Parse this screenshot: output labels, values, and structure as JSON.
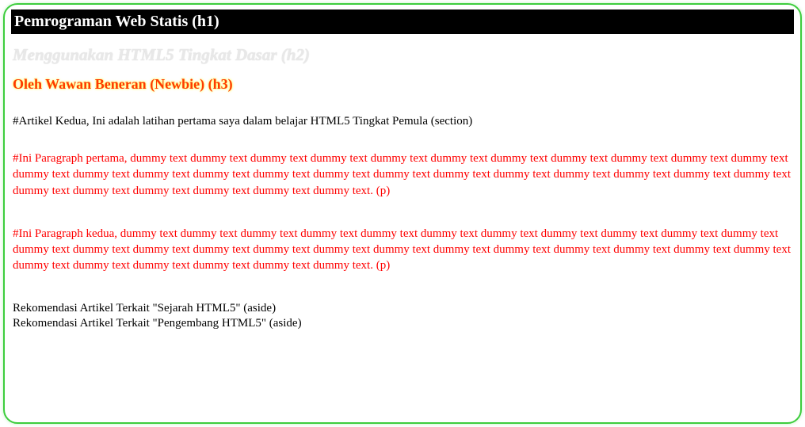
{
  "header": {
    "h1": "Pemrograman Web Statis (h1)",
    "h2": "Menggunakan HTML5 Tingkat Dasar (h2)",
    "h3": "Oleh Wawan Beneran (Newbie) (h3)"
  },
  "section": "#Artikel Kedua, Ini adalah latihan pertama saya dalam belajar HTML5 Tingkat Pemula (section)",
  "paragraphs": {
    "p1": "#Ini Paragraph pertama, dummy text dummy text dummy text dummy text dummy text dummy text dummy text dummy text dummy text dummy text dummy text dummy text dummy text dummy text dummy text dummy text dummy text dummy text dummy text dummy text dummy text dummy text dummy text dummy text dummy text dummy text dummy text dummy text dummy text dummy text. (p)",
    "p2": "#Ini Paragraph kedua, dummy text dummy text dummy text dummy text dummy text dummy text dummy text dummy text dummy text dummy text dummy text dummy text dummy text dummy text dummy text dummy text dummy text dummy text dummy text dummy text dummy text dummy text dummy text dummy text dummy text dummy text dummy text dummy text dummy text dummy text. (p)"
  },
  "asides": {
    "a1": "Rekomendasi Artikel Terkait \"Sejarah HTML5\" (aside)",
    "a2": "Rekomendasi Artikel Terkait \"Pengembang HTML5\" (aside)"
  }
}
